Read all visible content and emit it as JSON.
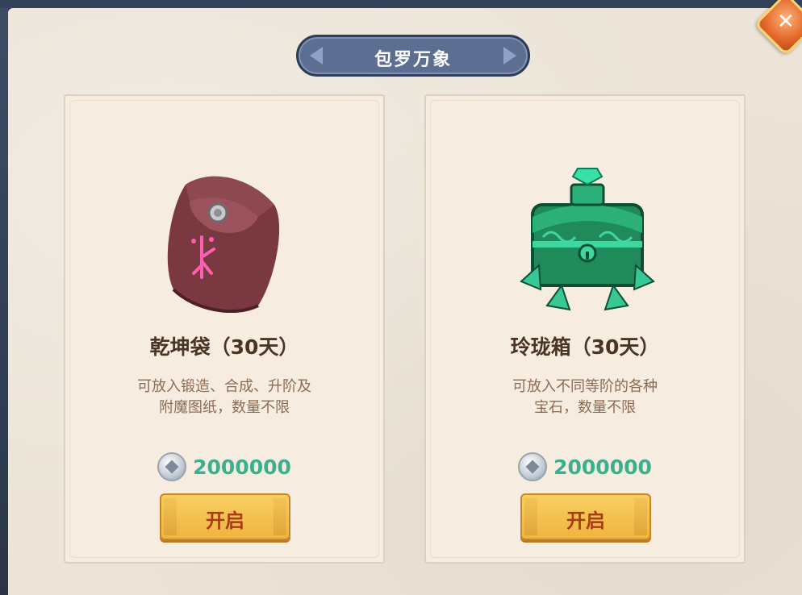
{
  "header": {
    "title": "包罗万象"
  },
  "cards": [
    {
      "icon": "pouch-icon",
      "name": "乾坤袋（30天）",
      "desc_line1": "可放入锻造、合成、升阶及",
      "desc_line2": "附魔图纸，数量不限",
      "price": "2000000",
      "button": "开启"
    },
    {
      "icon": "jade-chest-icon",
      "name": "玲珑箱（30天）",
      "desc_line1": "可放入不同等阶的各种",
      "desc_line2": "宝石，数量不限",
      "price": "2000000",
      "button": "开启"
    }
  ],
  "colors": {
    "title_banner": "#5c6e92",
    "price_text": "#3bb08e",
    "button_fill": "#f5c355",
    "button_text": "#a83c16"
  }
}
